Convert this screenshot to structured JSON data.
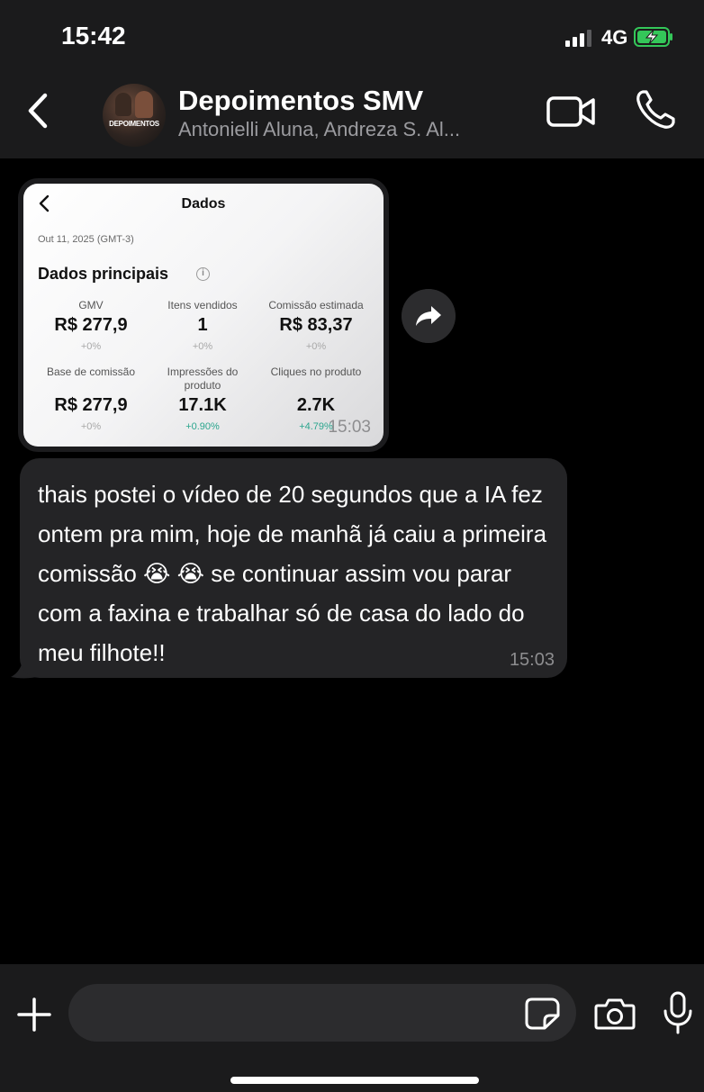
{
  "status_bar": {
    "time": "15:42",
    "network": "4G"
  },
  "header": {
    "title": "Depoimentos SMV",
    "subtitle": "Antonielli Aluna, Andreza S. Al...",
    "avatar_label": "DEPOIMENTOS"
  },
  "image_message": {
    "screen_title": "Dados",
    "date": "Out 11, 2025 (GMT-3)",
    "heading": "Dados principais",
    "metrics": [
      {
        "label": "GMV",
        "value": "R$ 277,9",
        "delta": "+0%"
      },
      {
        "label": "Itens vendidos",
        "value": "1",
        "delta": "+0%"
      },
      {
        "label": "Comissão estimada",
        "value": "R$ 83,37",
        "delta": "+0%"
      },
      {
        "label": "Base de comissão",
        "value": "R$ 277,9",
        "delta": "+0%"
      },
      {
        "label": "Impressões do produto",
        "value": "17.1K",
        "delta": "+0.90%"
      },
      {
        "label": "Cliques no produto",
        "value": "2.7K",
        "delta": "+4.79%"
      }
    ],
    "time": "15:03"
  },
  "text_message": {
    "text": "thais postei o vídeo de 20 segundos que a IA fez ontem pra mim, hoje de manhã já caiu a primeira comissão 😭 😭  se continuar assim vou parar com a faxina e trabalhar só de casa do lado do meu filhote!!",
    "time": "15:03"
  },
  "composer": {
    "placeholder": ""
  },
  "colors": {
    "background": "#000000",
    "bar": "#1b1b1c",
    "bubble": "#242426",
    "battery": "#34c759",
    "positive_delta": "#2ba58e"
  }
}
